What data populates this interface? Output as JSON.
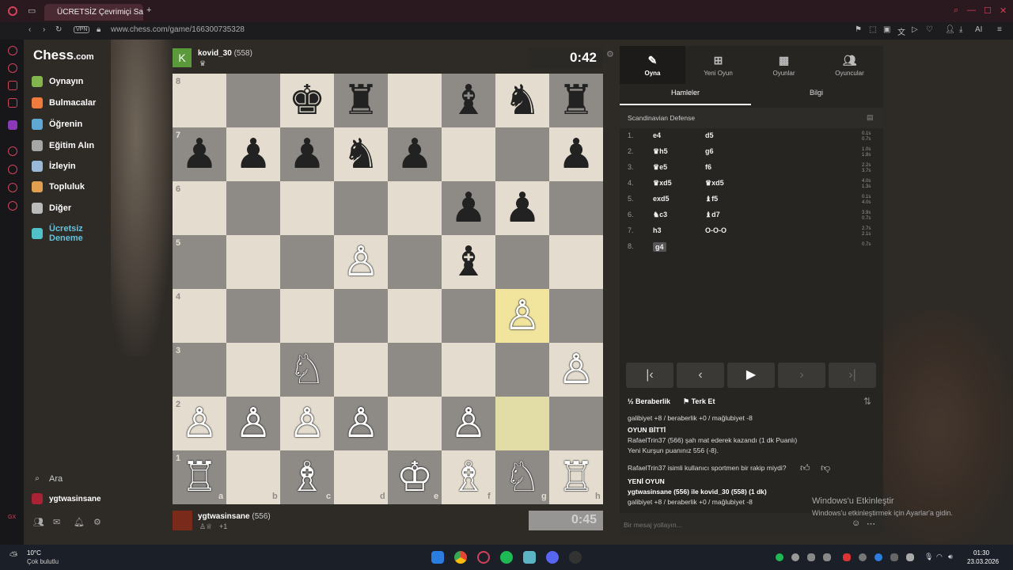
{
  "browser": {
    "tab_title": "ÜCRETSİZ Çevrimiçi Satranç",
    "url": "www.chess.com/game/166300735328",
    "vpn": "VPN",
    "ai": "AI"
  },
  "site": {
    "logo_main": "Chess",
    "logo_suffix": ".com"
  },
  "nav": [
    {
      "label": "Oynayın",
      "icon": "pawn-icon"
    },
    {
      "label": "Bulmacalar",
      "icon": "puzzle-icon"
    },
    {
      "label": "Öğrenin",
      "icon": "learn-icon"
    },
    {
      "label": "Eğitim Alın",
      "icon": "coach-icon"
    },
    {
      "label": "İzleyin",
      "icon": "watch-icon"
    },
    {
      "label": "Topluluk",
      "icon": "community-icon"
    },
    {
      "label": "Diğer",
      "icon": "more-icon"
    },
    {
      "label": "Ücretsiz Deneme",
      "icon": "diamond-icon"
    }
  ],
  "nav_bottom": {
    "search": "Ara",
    "user": "ygtwasinsane"
  },
  "top_player": {
    "avatar_letter": "K",
    "name": "kovid_30",
    "rating": "(558)"
  },
  "bottom_player": {
    "name": "ygtwasinsane",
    "rating": "(556)",
    "extra": "+1"
  },
  "clocks": {
    "top": "0:42",
    "bottom": "0:45"
  },
  "board": {
    "ranks": [
      "8",
      "7",
      "6",
      "5",
      "4",
      "3",
      "2",
      "1"
    ],
    "files": [
      "a",
      "b",
      "c",
      "d",
      "e",
      "f",
      "g",
      "h"
    ],
    "pieces": [
      {
        "sq": "c8",
        "p": "♚",
        "c": "b"
      },
      {
        "sq": "d8",
        "p": "♜",
        "c": "b"
      },
      {
        "sq": "f8",
        "p": "♝",
        "c": "b"
      },
      {
        "sq": "g8",
        "p": "♞",
        "c": "b"
      },
      {
        "sq": "h8",
        "p": "♜",
        "c": "b"
      },
      {
        "sq": "a7",
        "p": "♟",
        "c": "b"
      },
      {
        "sq": "b7",
        "p": "♟",
        "c": "b"
      },
      {
        "sq": "c7",
        "p": "♟",
        "c": "b"
      },
      {
        "sq": "d7",
        "p": "♞",
        "c": "b"
      },
      {
        "sq": "e7",
        "p": "♟",
        "c": "b"
      },
      {
        "sq": "h7",
        "p": "♟",
        "c": "b"
      },
      {
        "sq": "f6",
        "p": "♟",
        "c": "b"
      },
      {
        "sq": "g6",
        "p": "♟",
        "c": "b"
      },
      {
        "sq": "d5",
        "p": "♙",
        "c": "w"
      },
      {
        "sq": "f5",
        "p": "♝",
        "c": "b"
      },
      {
        "sq": "g4",
        "p": "♙",
        "c": "w"
      },
      {
        "sq": "c3",
        "p": "♘",
        "c": "w"
      },
      {
        "sq": "h3",
        "p": "♙",
        "c": "w"
      },
      {
        "sq": "a2",
        "p": "♙",
        "c": "w"
      },
      {
        "sq": "b2",
        "p": "♙",
        "c": "w"
      },
      {
        "sq": "c2",
        "p": "♙",
        "c": "w"
      },
      {
        "sq": "d2",
        "p": "♙",
        "c": "w"
      },
      {
        "sq": "f2",
        "p": "♙",
        "c": "w"
      },
      {
        "sq": "a1",
        "p": "♖",
        "c": "w"
      },
      {
        "sq": "c1",
        "p": "♗",
        "c": "w"
      },
      {
        "sq": "e1",
        "p": "♔",
        "c": "w"
      },
      {
        "sq": "f1",
        "p": "♗",
        "c": "w"
      },
      {
        "sq": "g1",
        "p": "♘",
        "c": "w"
      },
      {
        "sq": "h1",
        "p": "♖",
        "c": "w"
      }
    ],
    "highlight": [
      "g4",
      "g2"
    ]
  },
  "panel": {
    "tabs": [
      "Oyna",
      "Yeni Oyun",
      "Oyunlar",
      "Oyuncular"
    ],
    "subtabs": [
      "Hamleler",
      "Bilgi"
    ],
    "opening": "Scandinavian Defense",
    "moves": [
      {
        "n": "1.",
        "w": "e4",
        "b": "d5",
        "t": "0.1s 0.7s"
      },
      {
        "n": "2.",
        "w": "♛h5",
        "b": "g6",
        "t": "1.0s 1.8s"
      },
      {
        "n": "3.",
        "w": "♛e5",
        "b": "f6",
        "t": "2.2s 3.7s"
      },
      {
        "n": "4.",
        "w": "♛xd5",
        "b": "♛xd5",
        "t": "4.0s 1.3s"
      },
      {
        "n": "5.",
        "w": "exd5",
        "b": "♝f5",
        "t": "0.1s 4.0s"
      },
      {
        "n": "6.",
        "w": "♞c3",
        "b": "♝d7",
        "t": "3.9s 0.7s"
      },
      {
        "n": "7.",
        "w": "h3",
        "b": "O-O-O",
        "t": "2.7s 2.1s"
      },
      {
        "n": "8.",
        "w": "g4",
        "b": "",
        "t": "0.7s"
      }
    ],
    "draw": "Beraberlik",
    "resign": "Terk Et",
    "score_line": "galibiyet +8 / beraberlik +0 / mağlubiyet -8",
    "over_title": "OYUN BİTTİ",
    "over_text": "RafaelTrin37 (566) şah mat ederek kazandı (1 dk Puanlı)",
    "rating_text": "Yeni Kurşun puanınız 556 (-8).",
    "sport_q": "RafaelTrin37 isimli kullanıcı sportmen bir rakip miydi?",
    "new_game": "YENİ OYUN",
    "new_game_text": "ygtwasinsane (556) ile kovid_30 (558) (1 dk)",
    "score_line2": "galibiyet +8 / beraberlik +0 / mağlubiyet -8",
    "chat_placeholder": "Bir mesaj yollayın..."
  },
  "watermark": {
    "title": "Windows'u Etkinleştir",
    "sub": "Windows'u etkinleştirmek için Ayarlar'a gidin."
  },
  "taskbar": {
    "temp": "10°C",
    "weather": "Çok bulutlu",
    "time": "01:30",
    "date": "23.03.2026"
  }
}
